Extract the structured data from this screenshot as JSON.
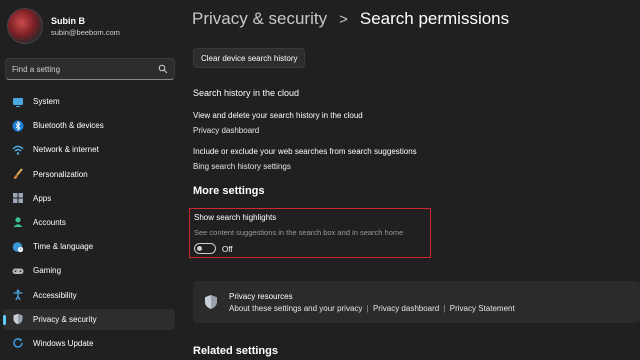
{
  "profile": {
    "name": "Subin B",
    "email": "subin@beebom.com"
  },
  "search": {
    "placeholder": "Find a setting",
    "icon": "search-icon"
  },
  "sidebar": {
    "items": [
      {
        "label": "System",
        "icon": "monitor-icon"
      },
      {
        "label": "Bluetooth & devices",
        "icon": "bluetooth-icon"
      },
      {
        "label": "Network & internet",
        "icon": "wifi-icon"
      },
      {
        "label": "Personalization",
        "icon": "brush-icon"
      },
      {
        "label": "Apps",
        "icon": "apps-icon"
      },
      {
        "label": "Accounts",
        "icon": "person-icon"
      },
      {
        "label": "Time & language",
        "icon": "globe-clock-icon"
      },
      {
        "label": "Gaming",
        "icon": "gamepad-icon"
      },
      {
        "label": "Accessibility",
        "icon": "accessibility-icon"
      },
      {
        "label": "Privacy & security",
        "icon": "shield-icon",
        "active": true
      },
      {
        "label": "Windows Update",
        "icon": "update-icon"
      }
    ]
  },
  "header": {
    "parent": "Privacy & security",
    "separator": ">",
    "current": "Search permissions"
  },
  "main": {
    "clear_button": "Clear device search history",
    "cloud_heading": "Search history in the cloud",
    "cloud_desc1": "View and delete your search history in the cloud",
    "cloud_link1": "Privacy dashboard",
    "cloud_desc2": "Include or exclude your web searches from search suggestions",
    "cloud_link2": "Bing search history settings",
    "more_settings": "More settings",
    "highlights": {
      "title": "Show search highlights",
      "desc": "See content suggestions in the search box and in search home",
      "toggle_state": "Off"
    },
    "resources": {
      "title": "Privacy resources",
      "links": [
        "About these settings and your privacy",
        "Privacy dashboard",
        "Privacy Statement"
      ],
      "separator": "|"
    },
    "related_settings": "Related settings"
  },
  "colors": {
    "background": "#202020",
    "accent": "#60cdff",
    "highlight_border": "#d0282f"
  }
}
